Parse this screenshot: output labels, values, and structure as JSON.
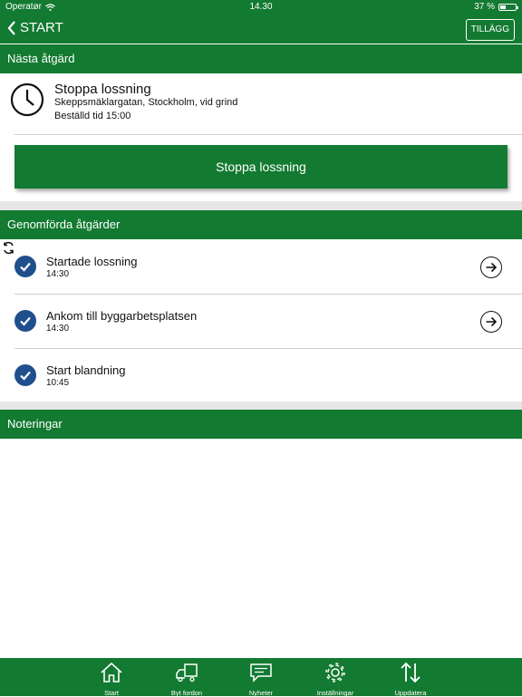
{
  "status_bar": {
    "carrier": "Operatør",
    "time": "14.30",
    "battery": "37 %",
    "battery_level": 0.37
  },
  "nav": {
    "back_label": "START",
    "tillagg_label": "TILLÄGG"
  },
  "next_action": {
    "header": "Nästa åtgärd",
    "title": "Stoppa lossning",
    "address": "Skeppsmäklargatan, Stockholm, vid grind",
    "ordered_time": "Beställd tid 15:00",
    "button_label": "Stoppa lossning"
  },
  "completed": {
    "header": "Genomförda åtgärder",
    "items": [
      {
        "title": "Startade lossning",
        "time": "14:30"
      },
      {
        "title": "Ankom till byggarbetsplatsen",
        "time": "14:30"
      },
      {
        "title": "Start blandning",
        "time": "10:45"
      }
    ]
  },
  "notes": {
    "header": "Noteringar"
  },
  "tabs": [
    {
      "label": "Start",
      "icon": "home-icon"
    },
    {
      "label": "Byt fordon",
      "icon": "truck-icon"
    },
    {
      "label": "Nyheter",
      "icon": "message-icon"
    },
    {
      "label": "Inställningar",
      "icon": "gear-icon"
    },
    {
      "label": "Uppdatera",
      "icon": "updown-arrows-icon"
    }
  ],
  "colors": {
    "primary_green": "#137a31",
    "check_blue": "#1f4f8c",
    "separator_gray": "#e6e6e6"
  }
}
